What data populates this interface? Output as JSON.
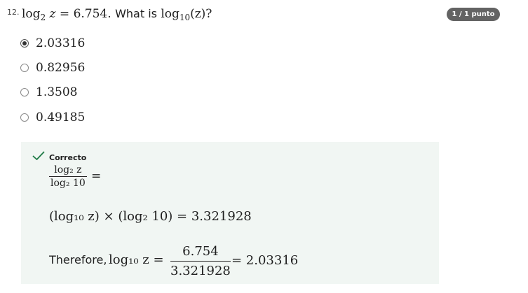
{
  "question": {
    "number": "12.",
    "log_word": "log",
    "base2": "2",
    "var": "z",
    "equals_value": "= 6.754.",
    "ask": "What is",
    "base10": "10",
    "ask_arg": "(z)?"
  },
  "score_badge": "1 / 1 punto",
  "options": [
    {
      "label": "2.03316",
      "selected": true
    },
    {
      "label": "0.82956",
      "selected": false
    },
    {
      "label": "1.3508",
      "selected": false
    },
    {
      "label": "0.49185",
      "selected": false
    }
  ],
  "feedback": {
    "status": "Correcto",
    "check_icon": "check-icon",
    "check_color": "#1e7a46",
    "frac1_num": "log₂ z",
    "frac1_den": "log₂ 10",
    "eq1": "=",
    "line2": "(log₁₀ z) × (log₂ 10) = 3.321928",
    "therefore": "Therefore,",
    "therefore_log": "log₁₀ z =",
    "frac2_num": "6.754",
    "frac2_den": "3.321928",
    "result": "= 2.03316"
  }
}
